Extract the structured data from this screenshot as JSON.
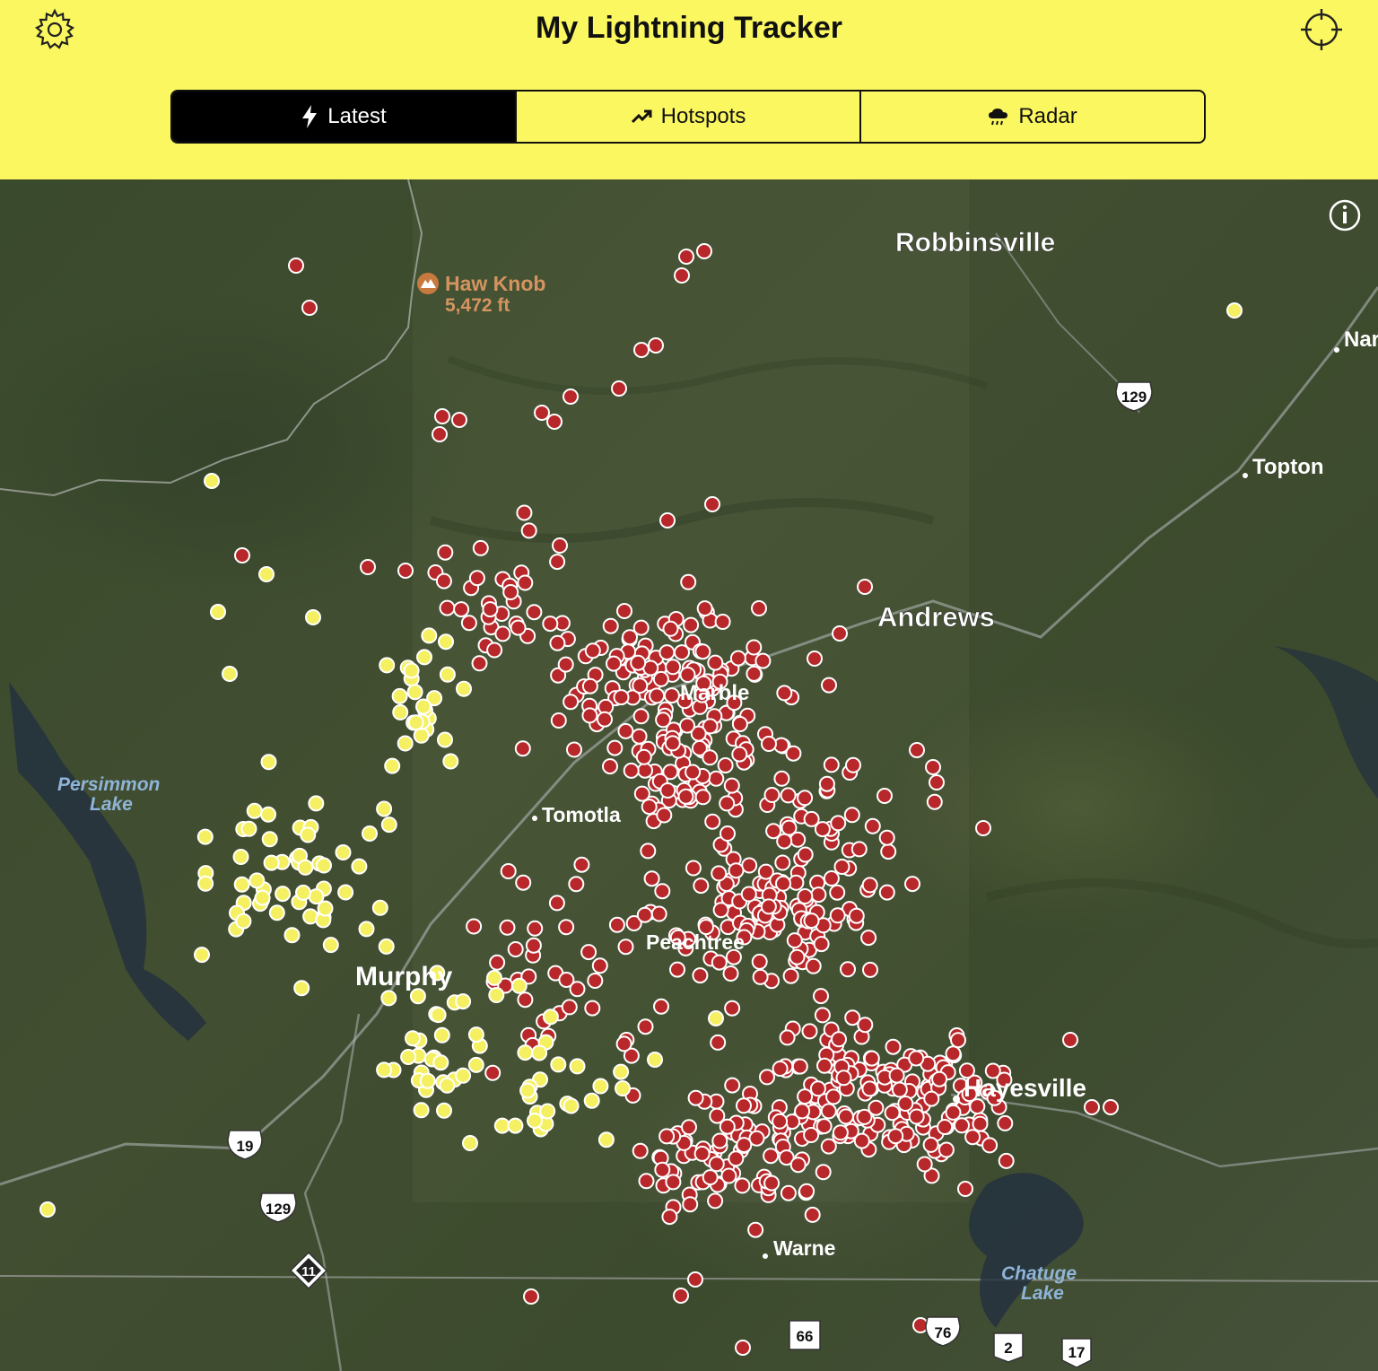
{
  "header": {
    "title": "My Lightning Tracker",
    "settings_icon": "gear-icon",
    "locate_icon": "crosshair-icon"
  },
  "tabs": [
    {
      "label": "Latest",
      "icon": "bolt-icon",
      "active": true
    },
    {
      "label": "Hotspots",
      "icon": "trend-up-icon",
      "active": false
    },
    {
      "label": "Radar",
      "icon": "rain-cloud-icon",
      "active": false
    }
  ],
  "map": {
    "info_icon": "info-icon",
    "places": [
      {
        "name": "Robbinsville"
      },
      {
        "name": "Haw Knob"
      },
      {
        "name": "5,472 ft"
      },
      {
        "name": "Nar"
      },
      {
        "name": "Topton"
      },
      {
        "name": "Andrews"
      },
      {
        "name": "Marble"
      },
      {
        "name": "Tomotla"
      },
      {
        "name": "Persimmon"
      },
      {
        "name": "Lake"
      },
      {
        "name": "Murphy"
      },
      {
        "name": "Peachtree"
      },
      {
        "name": "Hayesville"
      },
      {
        "name": "Warne"
      },
      {
        "name": "Chatuge"
      },
      {
        "name": "Lake"
      }
    ],
    "road_shields": [
      "129",
      "19",
      "129",
      "11",
      "66",
      "76",
      "2",
      "17"
    ],
    "colors": {
      "old_strike": "#b8272a",
      "recent_strike": "#f5f062",
      "stroke": "#ffffff"
    }
  }
}
